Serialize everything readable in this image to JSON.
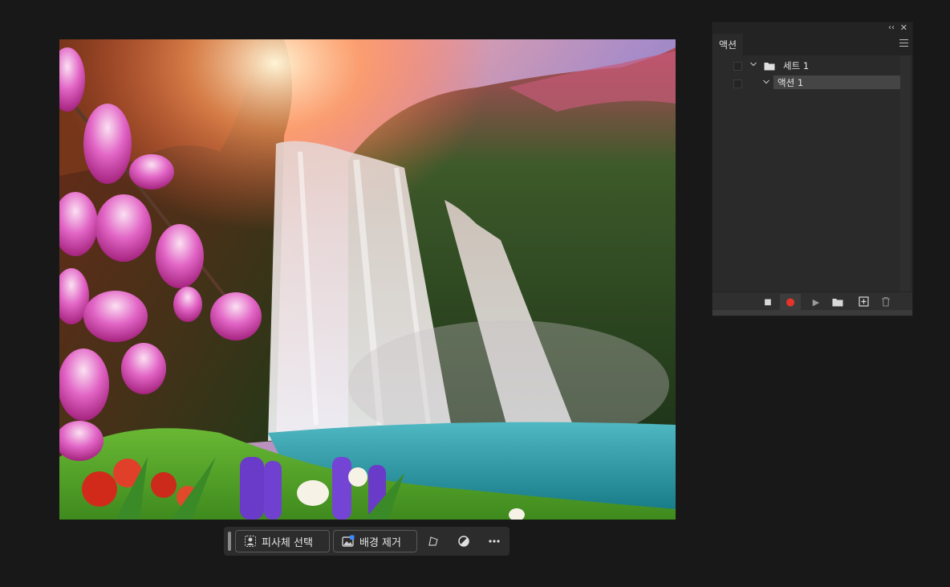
{
  "panel": {
    "tab_label": "액션",
    "collapse_glyph": "‹‹",
    "close_glyph": "✕",
    "menu_icon": "panel-menu-icon",
    "items": [
      {
        "label": "세트 1",
        "type": "set",
        "icon": "folder-icon",
        "expanded": true
      },
      {
        "label": "액션 1",
        "type": "action",
        "expanded": true,
        "selected": true
      }
    ],
    "footer_buttons": [
      {
        "name": "stop-button",
        "icon": "stop-icon",
        "glyph": "■"
      },
      {
        "name": "record-button",
        "icon": "record-icon",
        "glyph": "●",
        "color": "#e8332b",
        "active": true
      },
      {
        "name": "play-button",
        "icon": "play-icon",
        "glyph": "▶"
      },
      {
        "name": "new-set-button",
        "icon": "folder-icon"
      },
      {
        "name": "new-action-button",
        "icon": "add-icon"
      },
      {
        "name": "delete-button",
        "icon": "trash-icon"
      }
    ]
  },
  "taskbar": {
    "select_subject_label": "피사체 선택",
    "remove_background_label": "배경 제거",
    "icons": [
      "transform-icon",
      "adjustment-icon",
      "more-icon"
    ]
  },
  "colors": {
    "app_background": "#181818",
    "panel_background": "#2a2a2a",
    "record_red": "#e8332b",
    "selection": "#454545"
  }
}
